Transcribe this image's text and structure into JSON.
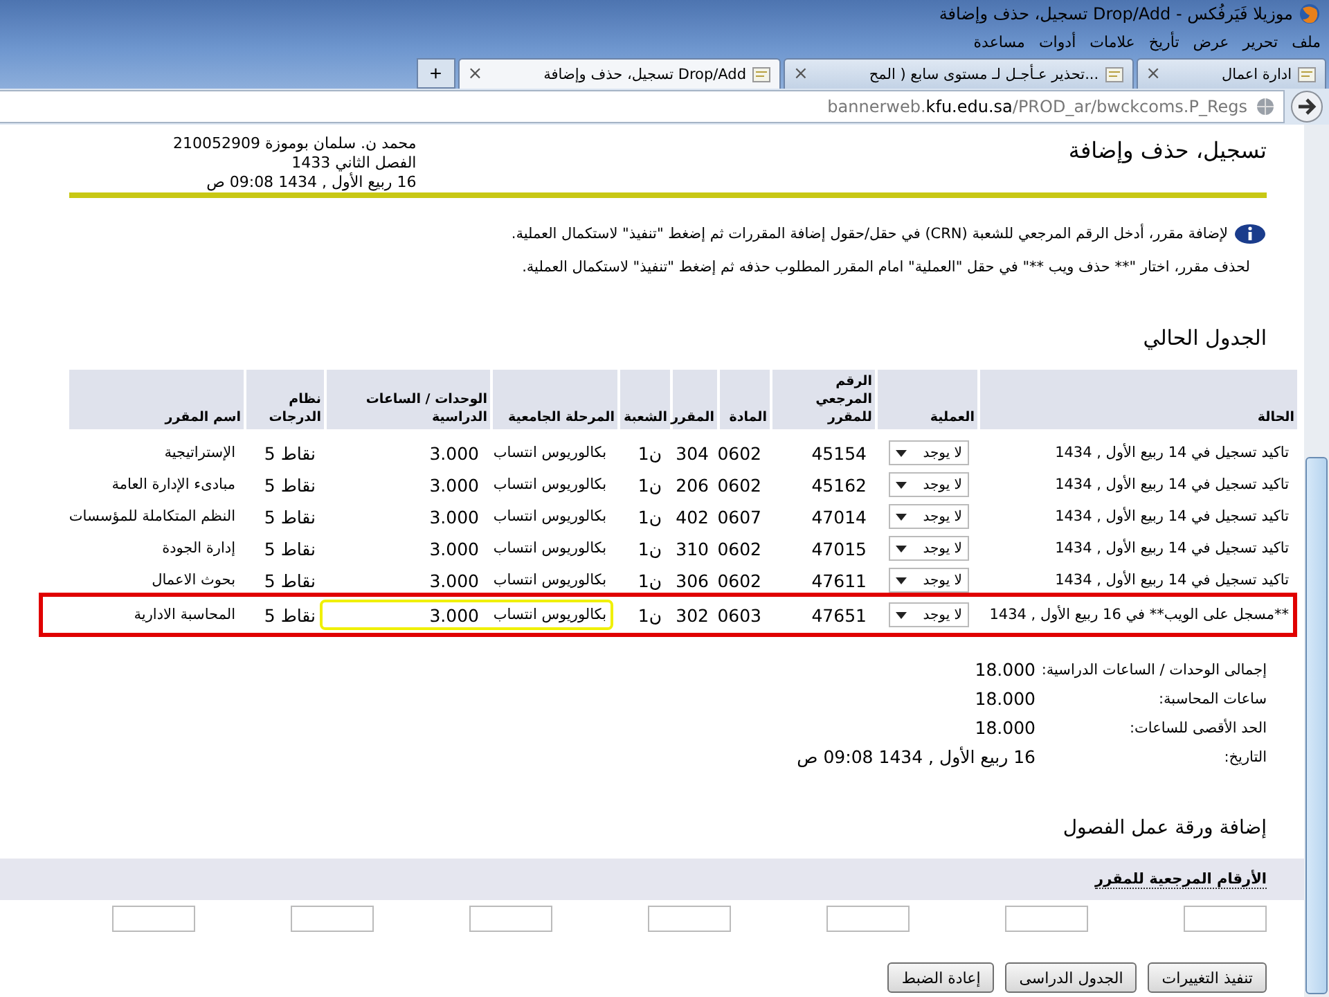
{
  "window": {
    "title": "تسجيل، حذف وإضافة Drop/Add - موزيلا فَيَرفُكس"
  },
  "menu": [
    "ملف",
    "تحرير",
    "عرض",
    "تأريخ",
    "علامات",
    "أدوات",
    "مساعدة"
  ],
  "tabs": [
    {
      "label": "ادارة اعمال",
      "close": "×",
      "selected": false
    },
    {
      "label": "تحذير عـأجـل لـ مستوى سابع ( المح...",
      "close": "×",
      "selected": false
    },
    {
      "label": "تسجيل، حذف وإضافة Drop/Add",
      "close": "×",
      "selected": true
    }
  ],
  "new_tab_button": "+",
  "address_bar": {
    "url": "bannerweb.**kfu.edu.sa**/PROD_ar/bwckcoms.P_Regs"
  },
  "page": {
    "title": "تسجيل، حذف وإضافة",
    "student_info": [
      "محمد ن. سلمان بوموزة 210052909",
      "الفصل الثاني 1433",
      "16 ربيع الأول , 1434 09:08 ص"
    ],
    "instructions": [
      "لإضافة مقرر، أدخل الرقم المرجعي للشعبة (CRN) في حقل/حقول إضافة المقررات ثم إضغط \"تنفيذ\" لاستكمال العملية.",
      "لحذف مقرر، اختار \"** حذف ويب **\" في حقل \"العملية\" امام المقرر المطلوب حذفه ثم إضغط \"تنفيذ\" لاستكمال العملية."
    ]
  },
  "current_schedule": {
    "heading": "الجدول الحالي",
    "columns": [
      "الحالة",
      "العملية",
      "الرقم المرجعي للمقرر",
      "المادة",
      "المقرر",
      "الشعبة",
      "المرحلة الجامعية",
      "الوحدات / الساعات الدراسية",
      "نظام الدرجات",
      "اسم المقرر"
    ],
    "rows": [
      {
        "status": "تاكيد تسجيل في 14 ربيع الأول , 1434",
        "action": "لا يوجد",
        "crn": "45154",
        "subject": "0602",
        "course": "304",
        "section": "ن1",
        "level": "بكالوريوس انتساب",
        "units": "3.000",
        "grade_mode": "نقاط 5",
        "title": "الإستراتيجية",
        "highlighted": false,
        "units_highlighted": false
      },
      {
        "status": "تاكيد تسجيل في 14 ربيع الأول , 1434",
        "action": "لا يوجد",
        "crn": "45162",
        "subject": "0602",
        "course": "206",
        "section": "ن1",
        "level": "بكالوريوس انتساب",
        "units": "3.000",
        "grade_mode": "نقاط 5",
        "title": "مبادىء الإدارة العامة",
        "highlighted": false,
        "units_highlighted": false
      },
      {
        "status": "تاكيد تسجيل في 14 ربيع الأول , 1434",
        "action": "لا يوجد",
        "crn": "47014",
        "subject": "0607",
        "course": "402",
        "section": "ن1",
        "level": "بكالوريوس انتساب",
        "units": "3.000",
        "grade_mode": "نقاط 5",
        "title": "النظم المتكاملة للمؤسسات",
        "highlighted": false,
        "units_highlighted": false
      },
      {
        "status": "تاكيد تسجيل في 14 ربيع الأول , 1434",
        "action": "لا يوجد",
        "crn": "47015",
        "subject": "0602",
        "course": "310",
        "section": "ن1",
        "level": "بكالوريوس انتساب",
        "units": "3.000",
        "grade_mode": "نقاط 5",
        "title": "إدارة الجودة",
        "highlighted": false,
        "units_highlighted": false
      },
      {
        "status": "تاكيد تسجيل في 14 ربيع الأول , 1434",
        "action": "لا يوجد",
        "crn": "47611",
        "subject": "0602",
        "course": "306",
        "section": "ن1",
        "level": "بكالوريوس انتساب",
        "units": "3.000",
        "grade_mode": "نقاط 5",
        "title": "بحوث الاعمال",
        "highlighted": false,
        "units_highlighted": false
      },
      {
        "status": "**مسجل على الويب** في 16 ربيع الأول , 1434",
        "action": "لا يوجد",
        "crn": "47651",
        "subject": "0603",
        "course": "302",
        "section": "ن1",
        "level": "بكالوريوس انتساب",
        "units": "3.000",
        "grade_mode": "نقاط 5",
        "title": "المحاسبة الادارية",
        "highlighted": true,
        "units_highlighted": true
      }
    ]
  },
  "summary": [
    {
      "label": "إجمالى الوحدات / الساعات الدراسية:",
      "value": "18.000"
    },
    {
      "label": "ساعات المحاسبة:",
      "value": "18.000"
    },
    {
      "label": "الحد الأقصى للساعات:",
      "value": "18.000"
    },
    {
      "label": "التاريخ:",
      "value": "16 ربيع الأول , 1434 09:08 ص"
    }
  ],
  "add_worksheet": {
    "heading": "إضافة ورقة عمل الفصول",
    "label": "الأرقام المرجعية للمقرر"
  },
  "buttons": [
    "تنفيذ التغييرات",
    "الجدول الدراسى",
    "إعادة الضبط"
  ]
}
